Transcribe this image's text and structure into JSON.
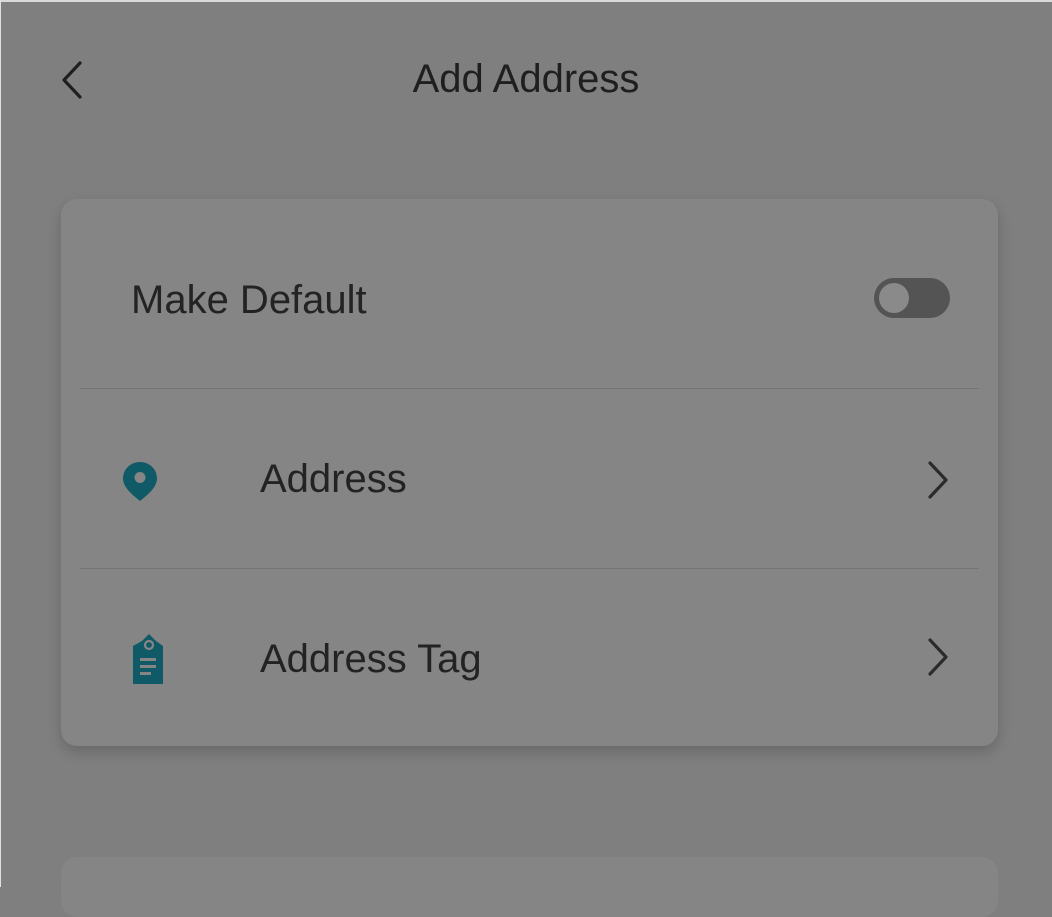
{
  "header": {
    "title": "Add Address",
    "back_icon": "chevron-left-icon"
  },
  "settings": {
    "make_default": {
      "label": "Make Default",
      "toggle_on": false
    },
    "items": [
      {
        "label": "Address",
        "icon": "location-pin-icon",
        "trailing_icon": "chevron-right-icon"
      },
      {
        "label": "Address Tag",
        "icon": "tag-icon",
        "trailing_icon": "chevron-right-icon"
      }
    ]
  },
  "colors": {
    "background_overlay": "#7f7f7f",
    "card": "#858585",
    "icon_accent": "#0f5a66",
    "text": "#232323",
    "toggle_track": "#545454"
  }
}
